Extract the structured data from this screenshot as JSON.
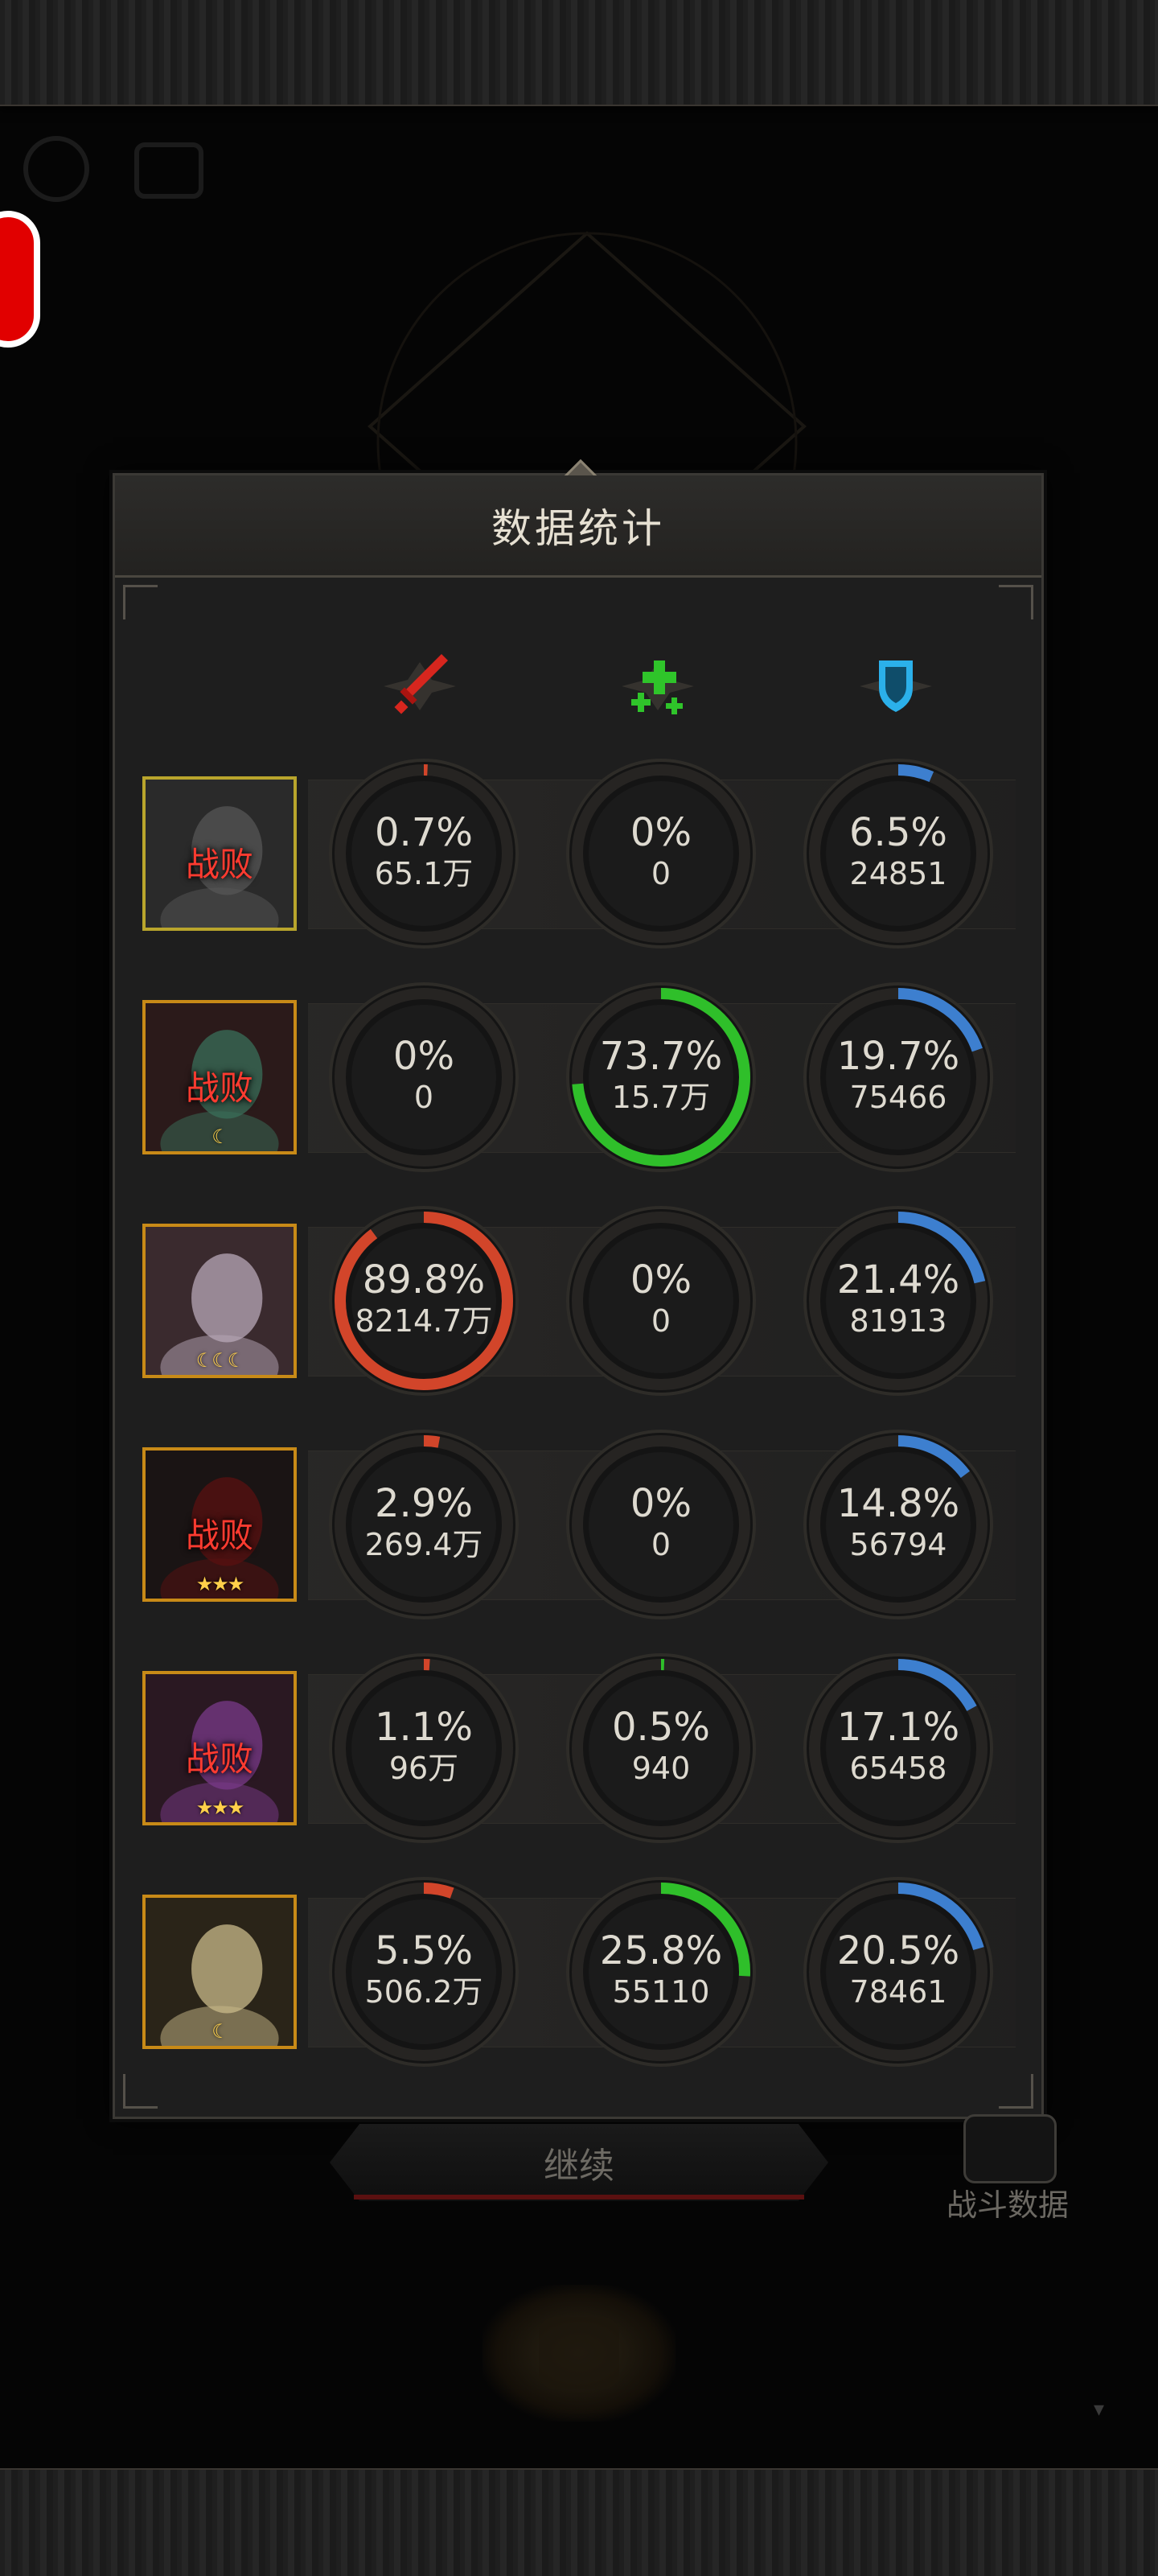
{
  "panel": {
    "title": "数据统计"
  },
  "columns": [
    {
      "name": "damage",
      "icon": "sword-icon",
      "color": "#d7261e"
    },
    {
      "name": "heal",
      "icon": "heal-plus-icon",
      "color": "#2fc42a"
    },
    {
      "name": "shield",
      "icon": "shield-icon",
      "color": "#2bb0ea"
    }
  ],
  "colors": {
    "damage_ring": "#d2452a",
    "heal_ring": "#2fbf2a",
    "shield_ring": "#3d7fcf",
    "defeat_text": "#ff3b30",
    "accent_frame": "#c88a17"
  },
  "rows": [
    {
      "defeat": "战败",
      "stars": "",
      "damage": {
        "pct": "0.7%",
        "amount": "65.1万",
        "fraction": 0.007
      },
      "heal": {
        "pct": "0%",
        "amount": "0",
        "fraction": 0
      },
      "shield": {
        "pct": "6.5%",
        "amount": "24851",
        "fraction": 0.065
      }
    },
    {
      "defeat": "战败",
      "stars": "☾",
      "damage": {
        "pct": "0%",
        "amount": "0",
        "fraction": 0
      },
      "heal": {
        "pct": "73.7%",
        "amount": "15.7万",
        "fraction": 0.737
      },
      "shield": {
        "pct": "19.7%",
        "amount": "75466",
        "fraction": 0.197
      }
    },
    {
      "defeat": "",
      "stars": "☾☾☾",
      "damage": {
        "pct": "89.8%",
        "amount": "8214.7万",
        "fraction": 0.898
      },
      "heal": {
        "pct": "0%",
        "amount": "0",
        "fraction": 0
      },
      "shield": {
        "pct": "21.4%",
        "amount": "81913",
        "fraction": 0.214
      }
    },
    {
      "defeat": "战败",
      "stars": "★★★",
      "damage": {
        "pct": "2.9%",
        "amount": "269.4万",
        "fraction": 0.029
      },
      "heal": {
        "pct": "0%",
        "amount": "0",
        "fraction": 0
      },
      "shield": {
        "pct": "14.8%",
        "amount": "56794",
        "fraction": 0.148
      }
    },
    {
      "defeat": "战败",
      "stars": "★★★",
      "damage": {
        "pct": "1.1%",
        "amount": "96万",
        "fraction": 0.011
      },
      "heal": {
        "pct": "0.5%",
        "amount": "940",
        "fraction": 0.005
      },
      "shield": {
        "pct": "17.1%",
        "amount": "65458",
        "fraction": 0.171
      }
    },
    {
      "defeat": "",
      "stars": "☾",
      "damage": {
        "pct": "5.5%",
        "amount": "506.2万",
        "fraction": 0.055
      },
      "heal": {
        "pct": "25.8%",
        "amount": "55110",
        "fraction": 0.258
      },
      "shield": {
        "pct": "20.5%",
        "amount": "78461",
        "fraction": 0.205
      }
    }
  ],
  "footer": {
    "continue_label": "继续",
    "battle_data_label": "战斗数据"
  }
}
